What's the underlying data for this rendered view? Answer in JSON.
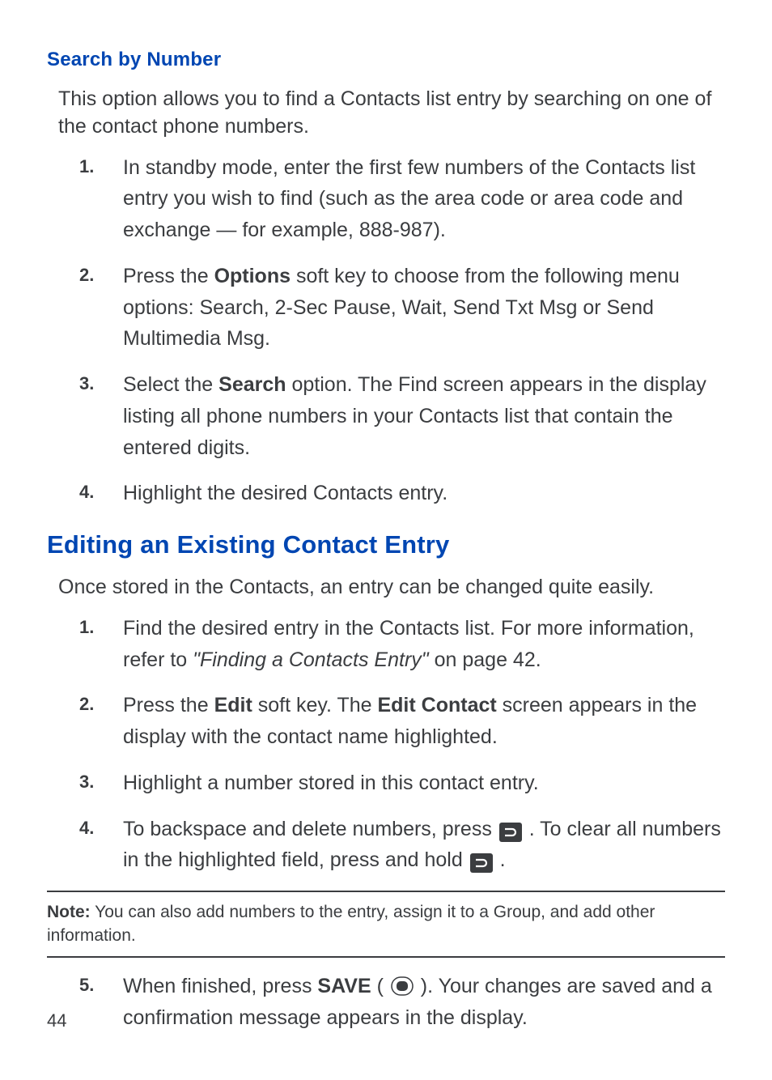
{
  "section1": {
    "heading": "Search by Number",
    "intro": "This option allows you to find a Contacts list entry by searching on one of the contact phone numbers.",
    "steps": [
      {
        "num": "1.",
        "text": "In standby mode, enter the first few numbers of the Contacts list entry you wish to find (such as the area code or area code and exchange — for example, 888-987)."
      },
      {
        "num": "2.",
        "pre": "Press the ",
        "bold": "Options",
        "post": " soft key to choose from the following menu options: Search, 2-Sec Pause, Wait, Send Txt Msg or Send Multimedia Msg."
      },
      {
        "num": "3.",
        "pre": "Select the ",
        "bold": "Search",
        "post": " option. The Find screen appears in the display listing all phone numbers in your Contacts list that contain the entered digits."
      },
      {
        "num": "4.",
        "text": "Highlight the desired Contacts entry."
      }
    ]
  },
  "section2": {
    "heading": "Editing an Existing Contact Entry",
    "intro": "Once stored in the Contacts, an entry can be changed quite easily.",
    "steps": [
      {
        "num": "1.",
        "pre": "Find the desired entry in the Contacts list. For more information, refer to ",
        "italic": "\"Finding a Contacts Entry\"",
        "post": "  on page 42."
      },
      {
        "num": "2.",
        "pre": "Press the ",
        "bold1": "Edit",
        "mid": " soft key. The ",
        "bold2": "Edit Contact",
        "post": " screen appears in the display with the contact name highlighted."
      },
      {
        "num": "3.",
        "text": "Highlight a number stored in this contact entry."
      },
      {
        "num": "4.",
        "pre": "To backspace and delete numbers, press ",
        "mid": " . To clear all numbers in the highlighted field, press and hold ",
        "post": " ."
      }
    ],
    "note": {
      "label": "Note:",
      "text": " You can also add numbers to the entry, assign it to a Group, and add other information."
    },
    "step5": {
      "num": "5.",
      "pre": "When finished, press ",
      "bold": "SAVE",
      "mid": " ( ",
      "post": " ). Your changes are saved and a confirmation message appears in the display."
    }
  },
  "page_number": "44"
}
